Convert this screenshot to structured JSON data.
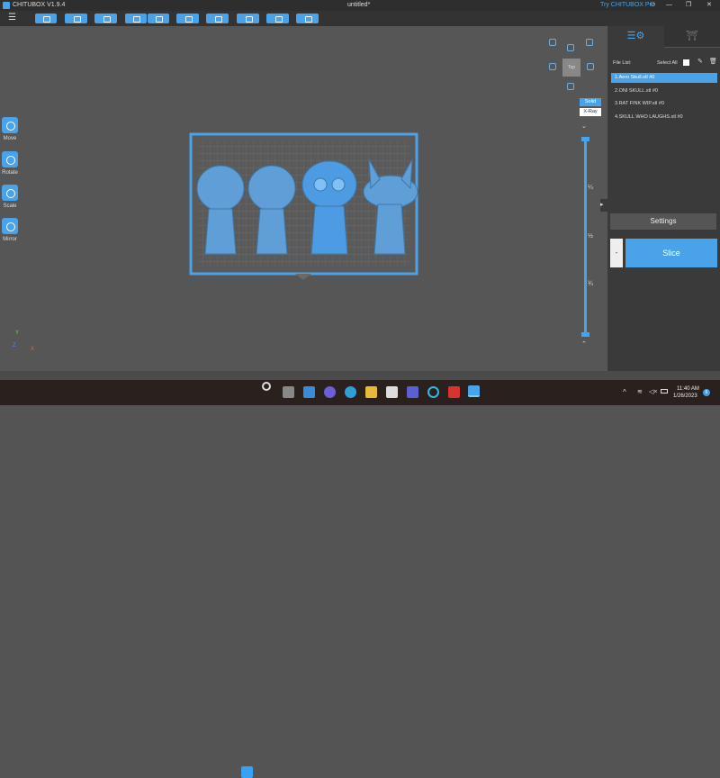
{
  "app": {
    "title": "CHITUBOX V1.9.4",
    "document": "untitled*",
    "promo": "Try CHITUBOX Pro"
  },
  "tools": [
    {
      "label": "Move"
    },
    {
      "label": "Rotate"
    },
    {
      "label": "Scale"
    },
    {
      "label": "Mirror"
    }
  ],
  "view": {
    "top_label": "Top",
    "solid": "Solid",
    "xray": "X-Ray"
  },
  "slider": {
    "marks": [
      "¼",
      "½",
      "¾"
    ]
  },
  "axes": {
    "y": "Y",
    "z": "Z",
    "x": "X"
  },
  "files": {
    "title": "File List:",
    "select_all": "Select All",
    "items": [
      "1.Aero Skull.stl #0",
      "2.ONI SKULL.stl #0",
      "3.RAT FINK WIP.stl #0",
      "4.SKULL WHO LAUGHS.stl #0"
    ],
    "selected": 0
  },
  "buttons": {
    "settings": "Settings",
    "slice": "Slice",
    "minus": "-"
  },
  "taskbar": {
    "time": "11:40 AM",
    "date": "1/26/2023",
    "badge": "6"
  },
  "colors": {
    "accent": "#4aa3e8"
  }
}
